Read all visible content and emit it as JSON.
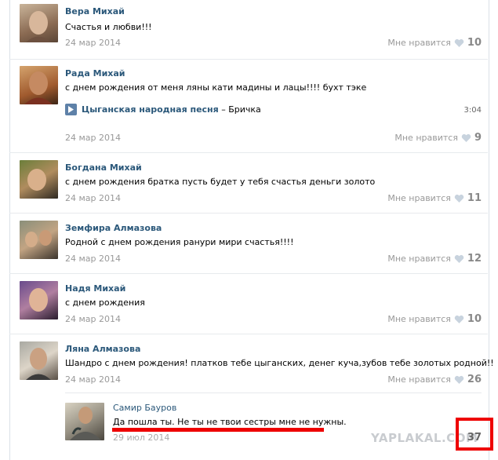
{
  "posts": [
    {
      "name": "Вера Михай",
      "text": "Счастья и любви!!!",
      "date": "24 мар 2014",
      "like_label": "Мне нравится",
      "likes": "10"
    },
    {
      "name": "Рада Михай",
      "text": "с днем рождения от меня ляны кати мадины и лацы!!!! бухт тэке",
      "audio": {
        "artist": "Цыганская народная песня",
        "dash": "–",
        "title": "Бричка",
        "duration": "3:04"
      },
      "date": "24 мар 2014",
      "like_label": "Мне нравится",
      "likes": "9"
    },
    {
      "name": "Богдана Михай",
      "text": "с днем рождения братка пусть будет у тебя счастья деньги золото",
      "date": "24 мар 2014",
      "like_label": "Мне нравится",
      "likes": "11"
    },
    {
      "name": "Земфира Алмазова",
      "text": "Родной с днем рождения ранури мири счастья!!!!",
      "date": "24 мар 2014",
      "like_label": "Мне нравится",
      "likes": "12"
    },
    {
      "name": "Надя Михай",
      "text": "с днем рождения",
      "date": "24 мар 2014",
      "like_label": "Мне нравится",
      "likes": "10"
    },
    {
      "name": "Ляна Алмазова",
      "text": "Шандро с днем рождения! платков тебе цыганских, денег куча,зубов тебе золотых родной!!",
      "date": "24 мар 2014",
      "like_label": "Мне нравится",
      "likes": "26"
    }
  ],
  "reply": {
    "name": "Самир Бауров",
    "text": "Да пошла ты. Не ты не твои сестры мне не нужны.",
    "date": "29 июл 2014",
    "likes": "37"
  },
  "watermark": "YAPLAKAL.COM",
  "colors": {
    "link": "#2b587a",
    "muted": "#999999",
    "highlight": "#ee0000"
  }
}
